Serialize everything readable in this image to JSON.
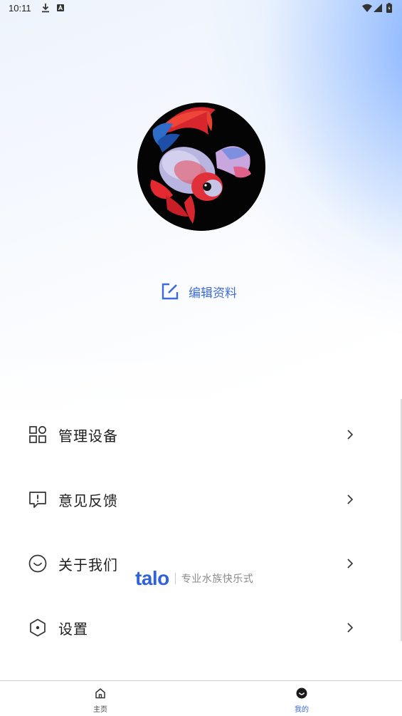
{
  "status_bar": {
    "time": "10:11",
    "left_icons": [
      "download-icon",
      "a-notification-icon"
    ],
    "right_icons": [
      "wifi-icon",
      "signal-icon",
      "battery-icon"
    ]
  },
  "profile": {
    "avatar_icon": "betta-fish-avatar",
    "edit_label": "编辑资料",
    "accent_color": "#3d6bd9"
  },
  "menu": {
    "items": [
      {
        "label": "管理设备",
        "icon": "grid-icon"
      },
      {
        "label": "意见反馈",
        "icon": "feedback-icon"
      },
      {
        "label": "关于我们",
        "icon": "smile-icon"
      },
      {
        "label": "设置",
        "icon": "settings-hexagon-icon"
      }
    ]
  },
  "watermark": {
    "logo": "talo",
    "slogan": "专业水族快乐式",
    "color": "#2f63d8"
  },
  "bottom_nav": {
    "items": [
      {
        "label": "主页",
        "icon": "home-icon",
        "active": false
      },
      {
        "label": "我的",
        "icon": "profile-icon",
        "active": true
      }
    ],
    "active_color": "#3d6bd9"
  }
}
